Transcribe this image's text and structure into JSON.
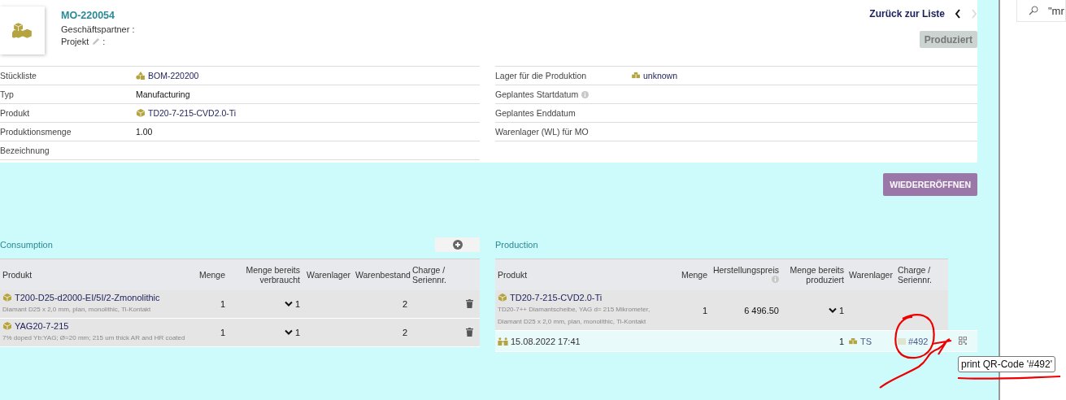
{
  "record": {
    "title": "MO-220054",
    "partner_label": "Geschäftspartner :",
    "project_label": "Projekt",
    "project_colon": ":"
  },
  "nav": {
    "back": "Zurück zur Liste",
    "next_disabled": true
  },
  "status_button": {
    "label": "Produziert",
    "disabled": true
  },
  "fields_left": [
    {
      "label": "Stückliste",
      "value": "BOM-220200",
      "kind": "bom",
      "info": false
    },
    {
      "label": "Typ",
      "value": "Manufacturing",
      "kind": "text",
      "info": false
    },
    {
      "label": "Produkt",
      "value": "TD20-7-215-CVD2.0-Ti",
      "kind": "product",
      "info": false
    },
    {
      "label": "Produktionsmenge",
      "value": "1.00",
      "kind": "text",
      "info": false
    },
    {
      "label": "Bezeichnung",
      "info": false
    }
  ],
  "fields_right": [
    {
      "label": "Lager für die Produktion",
      "value": "unknown",
      "kind": "warehouse",
      "info": false
    },
    {
      "label": "Geplantes Startdatum",
      "info": true
    },
    {
      "label": "Geplantes Enddatum",
      "info": false
    },
    {
      "label": "Warenlager (WL) für MO",
      "info": false
    }
  ],
  "reopen_button": "WIEDERERÖFFNEN",
  "consumption": {
    "title": "Consumption",
    "columns": [
      {
        "label": "Produkt",
        "info": false
      },
      {
        "label": "Menge",
        "info": false
      },
      {
        "label": "Menge bereits verbraucht",
        "info": false
      },
      {
        "label": "Warenlager",
        "info": false
      },
      {
        "label": "Warenbestand",
        "info": false
      },
      {
        "label": "Charge / Seriennr.",
        "info": false
      }
    ],
    "rows": [
      {
        "product": "T200-D25-d2000-EI/5I/2-Zmonolithic",
        "description": "Diamant D25 x 2,0 mm, plan, monolithic, Ti-Kontakt",
        "quantity": "1",
        "consumed": "1",
        "stock": "2"
      },
      {
        "product": "YAG20-7-215",
        "description": "7% doped Yb:YAG; Ø=20 mm; 215 um thick AR and HR coated",
        "quantity": "1",
        "consumed": "1",
        "stock": "2"
      }
    ]
  },
  "production": {
    "title": "Production",
    "columns": [
      {
        "label": "Produkt",
        "info": false
      },
      {
        "label": "Menge",
        "info": false
      },
      {
        "label": "Herstellungspreis",
        "info": true
      },
      {
        "label": "Menge bereits produziert",
        "info": false
      },
      {
        "label": "Warenlager",
        "info": false
      },
      {
        "label": "Charge / Seriennr.",
        "info": false
      }
    ],
    "rows": [
      {
        "product": "TD20-7-215-CVD2.0-Ti",
        "description": "TD20-7++ Diamantscheibe, YAG d= 215 Mikrometer, Diamant D25 x 2,0 mm, plan, monolithic, Ti-Kontakt",
        "quantity": "1",
        "cost": "6 496.50",
        "produced": "1",
        "lots": [
          {
            "date": "15.08.2022 17:41",
            "quantity": "1",
            "warehouse": "TS",
            "lot": "#492"
          }
        ]
      }
    ]
  },
  "tooltip": "print QR-Code '#492'",
  "search": {
    "value": "\"mr"
  }
}
